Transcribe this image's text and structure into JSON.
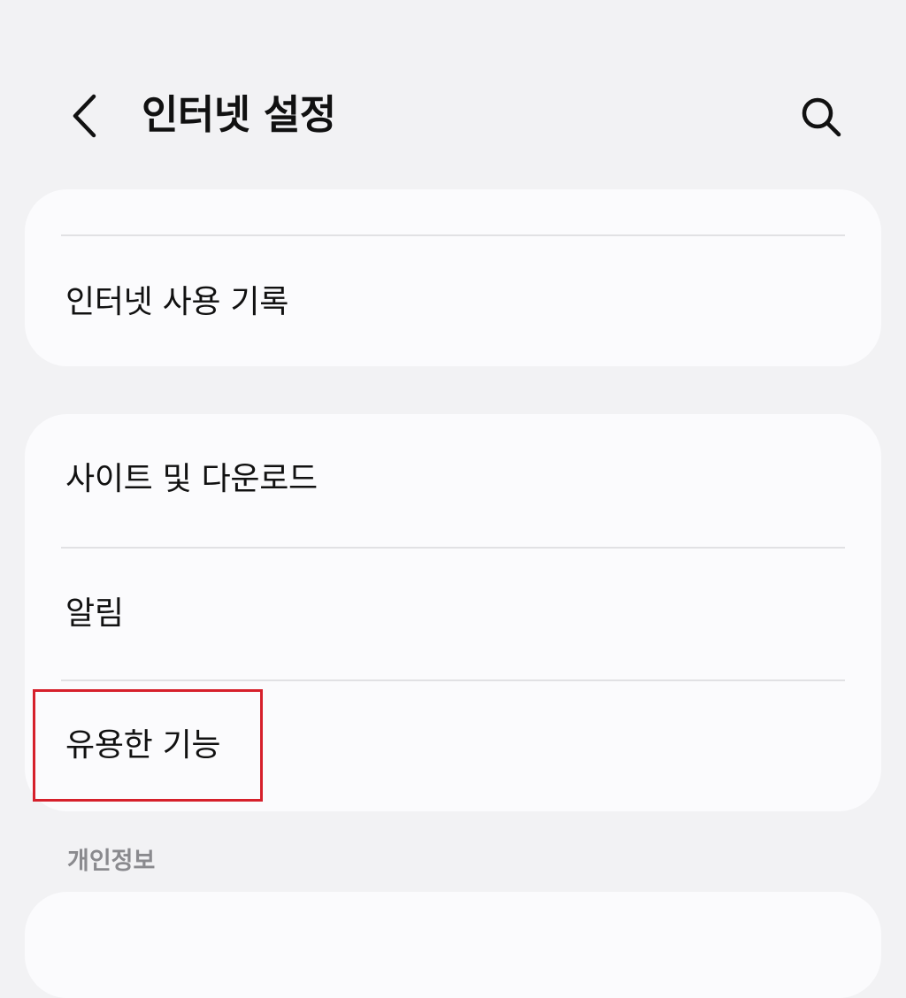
{
  "header": {
    "title": "인터넷 설정",
    "back_icon": "chevron-left-icon",
    "search_icon": "search-icon"
  },
  "groups": [
    {
      "items": [
        {
          "label": "인터넷 사용 기록"
        }
      ]
    },
    {
      "items": [
        {
          "label": "사이트 및 다운로드"
        },
        {
          "label": "알림"
        },
        {
          "label": "유용한 기능",
          "highlighted": true
        }
      ]
    }
  ],
  "sections": {
    "privacy_label": "개인정보"
  },
  "colors": {
    "background": "#f2f2f4",
    "card": "#fbfbfd",
    "highlight": "#d6202b",
    "section_label": "#8a8a8e"
  }
}
